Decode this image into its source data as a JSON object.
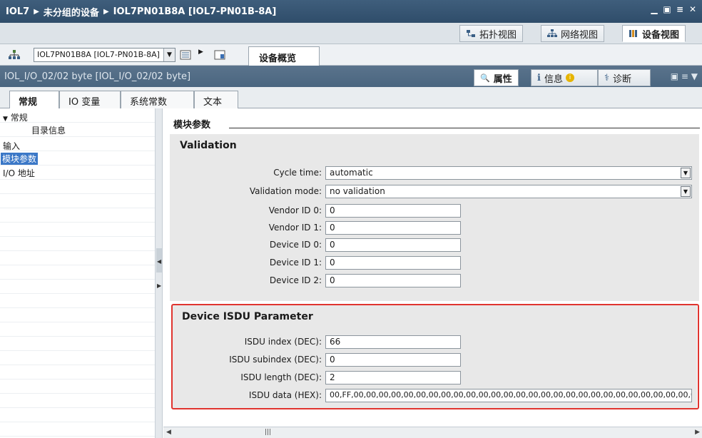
{
  "title": {
    "crumbs": [
      "IOL7",
      "未分组的设备",
      "IOL7PN01B8A [IOL7-PN01B-8A]"
    ]
  },
  "views": [
    {
      "label": "拓扑视图",
      "icon": "topology-icon"
    },
    {
      "label": "网络视图",
      "icon": "network-icon"
    },
    {
      "label": "设备视图",
      "icon": "device-icon"
    }
  ],
  "toolbar": {
    "device_select": "IOL7PN01B8A [IOL7-PN01B-8A]",
    "tab_overview": "设备概览"
  },
  "props": {
    "object": "IOL_I/O_02/02 byte [IOL_I/O_02/02 byte]",
    "tabs": [
      "属性",
      "信息",
      "诊断"
    ]
  },
  "subtabs": [
    "常规",
    "IO 变量",
    "系统常数",
    "文本"
  ],
  "nav": {
    "group": "常规",
    "items": [
      "目录信息",
      "输入",
      "模块参数",
      "I/O 地址"
    ]
  },
  "section": {
    "title": "模块参数"
  },
  "validation": {
    "title": "Validation",
    "cycle_time": {
      "label": "Cycle time:",
      "value": "automatic"
    },
    "validation_mode": {
      "label": "Validation mode:",
      "value": "no validation"
    },
    "vendor_id_0": {
      "label": "Vendor ID 0:",
      "value": "0"
    },
    "vendor_id_1": {
      "label": "Vendor ID 1:",
      "value": "0"
    },
    "device_id_0": {
      "label": "Device ID 0:",
      "value": "0"
    },
    "device_id_1": {
      "label": "Device ID 1:",
      "value": "0"
    },
    "device_id_2": {
      "label": "Device ID 2:",
      "value": "0"
    }
  },
  "isdu": {
    "title": "Device ISDU Parameter",
    "index": {
      "label": "ISDU index (DEC):",
      "value": "66"
    },
    "subindex": {
      "label": "ISDU subindex (DEC):",
      "value": "0"
    },
    "length": {
      "label": "ISDU length (DEC):",
      "value": "2"
    },
    "data": {
      "label": "ISDU data (HEX):",
      "value": "00,FF,00,00,00,00,00,00,00,00,00,00,00,00,00,00,00,00,00,00,00,00,00,00,00,00,00,00,00,00,00,00,0"
    }
  },
  "colors": {
    "title_bg": "#3f5e7c",
    "highlight_box": "#e0342f",
    "selection": "#3b78c7"
  }
}
